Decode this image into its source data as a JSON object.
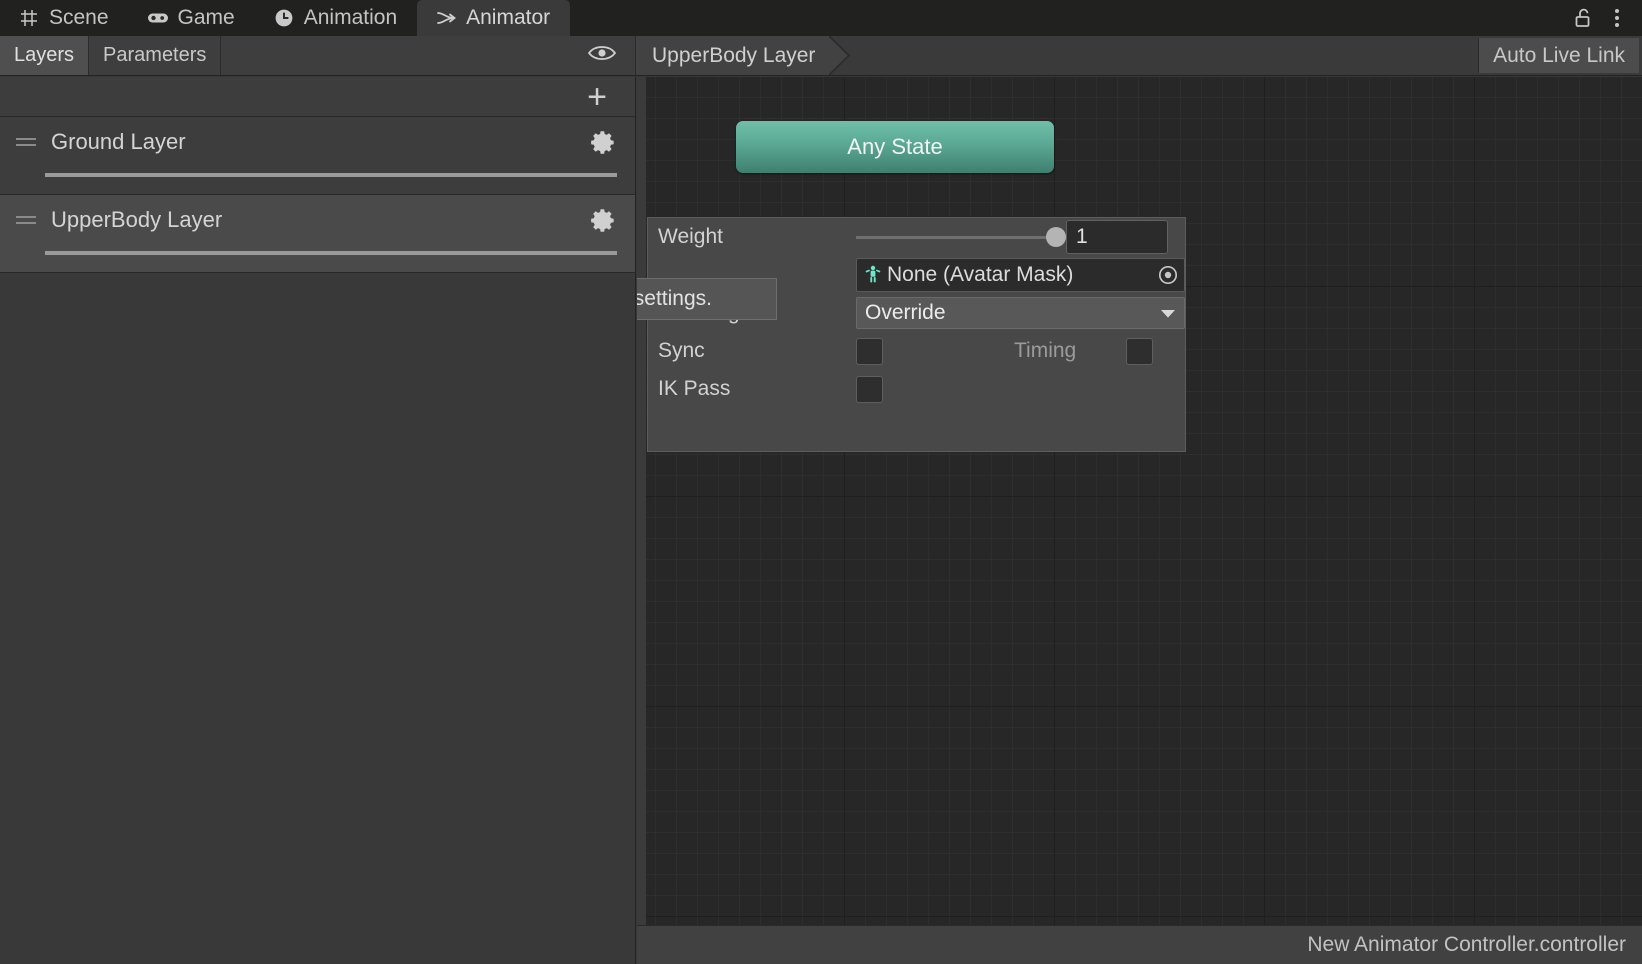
{
  "window": {
    "tabs": [
      {
        "label": "Scene",
        "icon": "grid-icon",
        "active": false
      },
      {
        "label": "Game",
        "icon": "gamepad-icon",
        "active": false
      },
      {
        "label": "Animation",
        "icon": "clock-icon",
        "active": false
      },
      {
        "label": "Animator",
        "icon": "animator-icon",
        "active": true
      }
    ],
    "lock_icon": "unlocked-padlock-icon",
    "menu_icon": "kebab-menu-icon"
  },
  "toolbar": {
    "layers_tab": "Layers",
    "parameters_tab": "Parameters",
    "eye_icon": "eye-icon",
    "breadcrumb": "UpperBody Layer",
    "auto_live_link": "Auto Live Link"
  },
  "layers_panel": {
    "add_label": "+",
    "items": [
      {
        "name": "Ground Layer",
        "selected": false,
        "weight_fill": 100,
        "gear_icon": "gear-icon",
        "handle_icon": "drag-handle-icon"
      },
      {
        "name": "UpperBody Layer",
        "selected": true,
        "weight_fill": 100,
        "gear_icon": "gear-icon",
        "handle_icon": "drag-handle-icon"
      }
    ]
  },
  "graph": {
    "any_state_label": "Any State",
    "any_state_color": "#5aa894"
  },
  "layer_settings": {
    "weight_label": "Weight",
    "weight_value": "1",
    "weight_slider_pct": 100,
    "mask_value": "None (Avatar Mask)",
    "mask_icon": "avatar-mask-icon",
    "picker_icon": "object-picker-icon",
    "blending_label": "Blending",
    "blending_value": "Override",
    "sync_label": "Sync",
    "sync_checked": false,
    "timing_label": "Timing",
    "timing_checked": false,
    "ik_pass_label": "IK Pass",
    "ik_pass_checked": false
  },
  "tooltip": {
    "text": "Click to change layer settings."
  },
  "statusbar": {
    "asset_name": "New Animator Controller.controller"
  }
}
